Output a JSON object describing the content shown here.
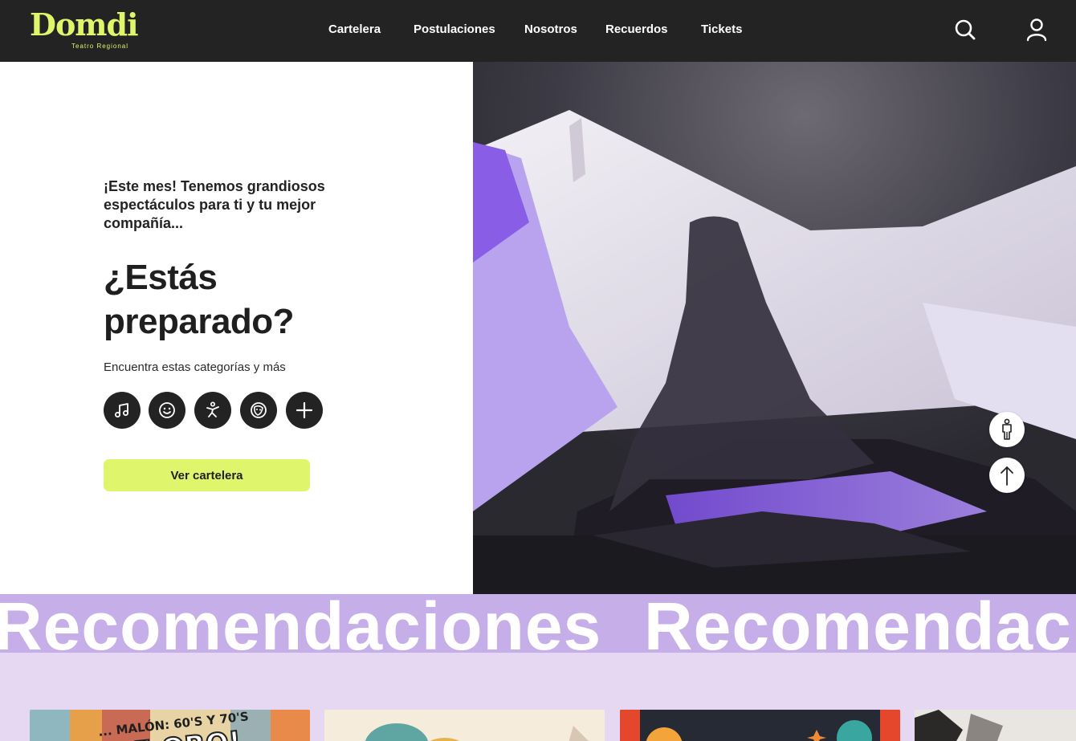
{
  "brand": {
    "name": "Domdi",
    "tagline": "Teatro Regional",
    "color": "#dff56b"
  },
  "nav": [
    {
      "label": "Cartelera"
    },
    {
      "label": "Postulaciones"
    },
    {
      "label": "Nosotros"
    },
    {
      "label": "Recuerdos"
    },
    {
      "label": "Tickets"
    }
  ],
  "header_icons": [
    "search-icon",
    "user-icon"
  ],
  "hero": {
    "intro": "¡Este mes! Tenemos grandiosos espectáculos para ti y tu mejor compañía...",
    "headline": "¿Estás preparado?",
    "categories_label": "Encuentra estas categorías y más",
    "categories": [
      "music-icon",
      "smiley-icon",
      "dance-icon",
      "theater-icon",
      "plus-icon"
    ],
    "cta_label": "Ver cartelera",
    "image": "stage-dancer-under-fabric"
  },
  "floating_buttons": [
    "accessibility-icon",
    "arrow-up-icon"
  ],
  "marquee": {
    "text": "Recomendaciones",
    "background": "#c6aee8"
  },
  "recommendations": {
    "background": "#e6d8f3",
    "cards": [
      {
        "caption": "... MALÓN: 60'S Y 70'S",
        "title": "DE ORO!"
      },
      {
        "caption": ""
      },
      {
        "caption": ""
      },
      {
        "caption": ""
      }
    ]
  }
}
